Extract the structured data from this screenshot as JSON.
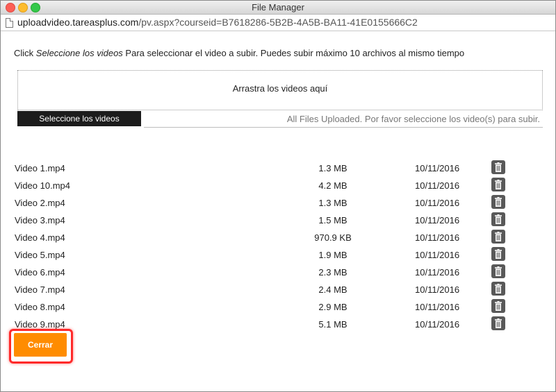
{
  "window": {
    "title": "File Manager",
    "url_host": "uploadvideo.tareasplus.com",
    "url_path": "/pv.aspx?courseid=B7618286-5B2B-4A5B-BA11-41E0155666C2"
  },
  "instructions": {
    "prefix": "Click ",
    "emphasis": "Seleccione los videos",
    "suffix": " Para seleccionar el video a subir. Puedes subir máximo 10 archivos al mismo tiempo"
  },
  "dropzone": {
    "label": "Arrastra los videos aquí"
  },
  "select_button": {
    "label": "Seleccione los videos"
  },
  "status_text": "All Files Uploaded. Por favor seleccione los video(s) para subir.",
  "files": [
    {
      "name": "Video 1.mp4",
      "size": "1.3 MB",
      "date": "10/11/2016"
    },
    {
      "name": "Video 10.mp4",
      "size": "4.2 MB",
      "date": "10/11/2016"
    },
    {
      "name": "Video 2.mp4",
      "size": "1.3 MB",
      "date": "10/11/2016"
    },
    {
      "name": "Video 3.mp4",
      "size": "1.5 MB",
      "date": "10/11/2016"
    },
    {
      "name": "Video 4.mp4",
      "size": "970.9 KB",
      "date": "10/11/2016"
    },
    {
      "name": "Video 5.mp4",
      "size": "1.9 MB",
      "date": "10/11/2016"
    },
    {
      "name": "Video 6.mp4",
      "size": "2.3 MB",
      "date": "10/11/2016"
    },
    {
      "name": "Video 7.mp4",
      "size": "2.4 MB",
      "date": "10/11/2016"
    },
    {
      "name": "Video 8.mp4",
      "size": "2.9 MB",
      "date": "10/11/2016"
    },
    {
      "name": "Video 9.mp4",
      "size": "5.1 MB",
      "date": "10/11/2016"
    }
  ],
  "close_button": {
    "label": "Cerrar"
  },
  "colors": {
    "accent": "#ff8c00",
    "highlight": "#ff2a2a",
    "select_button_bg": "#1c1c1c",
    "delete_button_bg": "#595959"
  },
  "icons": {
    "delete": "trash-icon",
    "page": "document-icon"
  }
}
